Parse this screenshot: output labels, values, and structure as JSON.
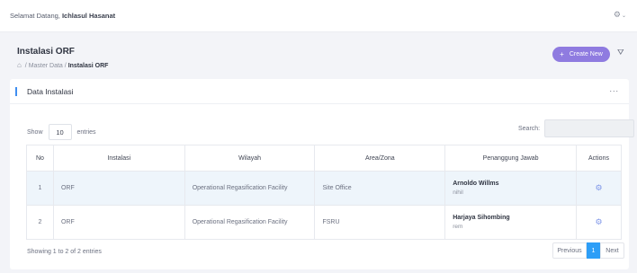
{
  "topbar": {
    "greeting": "Selamat Datang,",
    "user_name": "Ichlasul Hasanat"
  },
  "header": {
    "title": "Instalasi ORF",
    "breadcrumb": [
      "Master Data",
      "Instalasi ORF"
    ],
    "breadcrumb_separator": "/",
    "create_label": "Create New"
  },
  "card": {
    "title": "Data Instalasi",
    "more_label": "..."
  },
  "table_controls": {
    "show_label": "Show",
    "page_length": "10",
    "entries_label": "entries",
    "search_label": "Search:",
    "search_value": ""
  },
  "table": {
    "columns": [
      "No",
      "Instalasi",
      "Wilayah",
      "Area/Zona",
      "Penanggung Jawab",
      "Actions"
    ],
    "rows": [
      {
        "no": "1",
        "instalasi": "ORF",
        "wilayah": "Operational Regasification Facility",
        "area": "Site Office",
        "pj_name": "Arnoldo Willms",
        "pj_sub": "nihil"
      },
      {
        "no": "2",
        "instalasi": "ORF",
        "wilayah": "Operational Regasification Facility",
        "area": "FSRU",
        "pj_name": "Harjaya Sihombing",
        "pj_sub": "rem"
      }
    ]
  },
  "footer": {
    "info": "Showing 1 to 2 of 2 entries",
    "prev_label": "Previous",
    "current_page": "1",
    "next_label": "Next"
  },
  "colors": {
    "accent": "#8f7be0",
    "primary": "#2d9ef7",
    "card_bar": "#3f8ef0"
  }
}
